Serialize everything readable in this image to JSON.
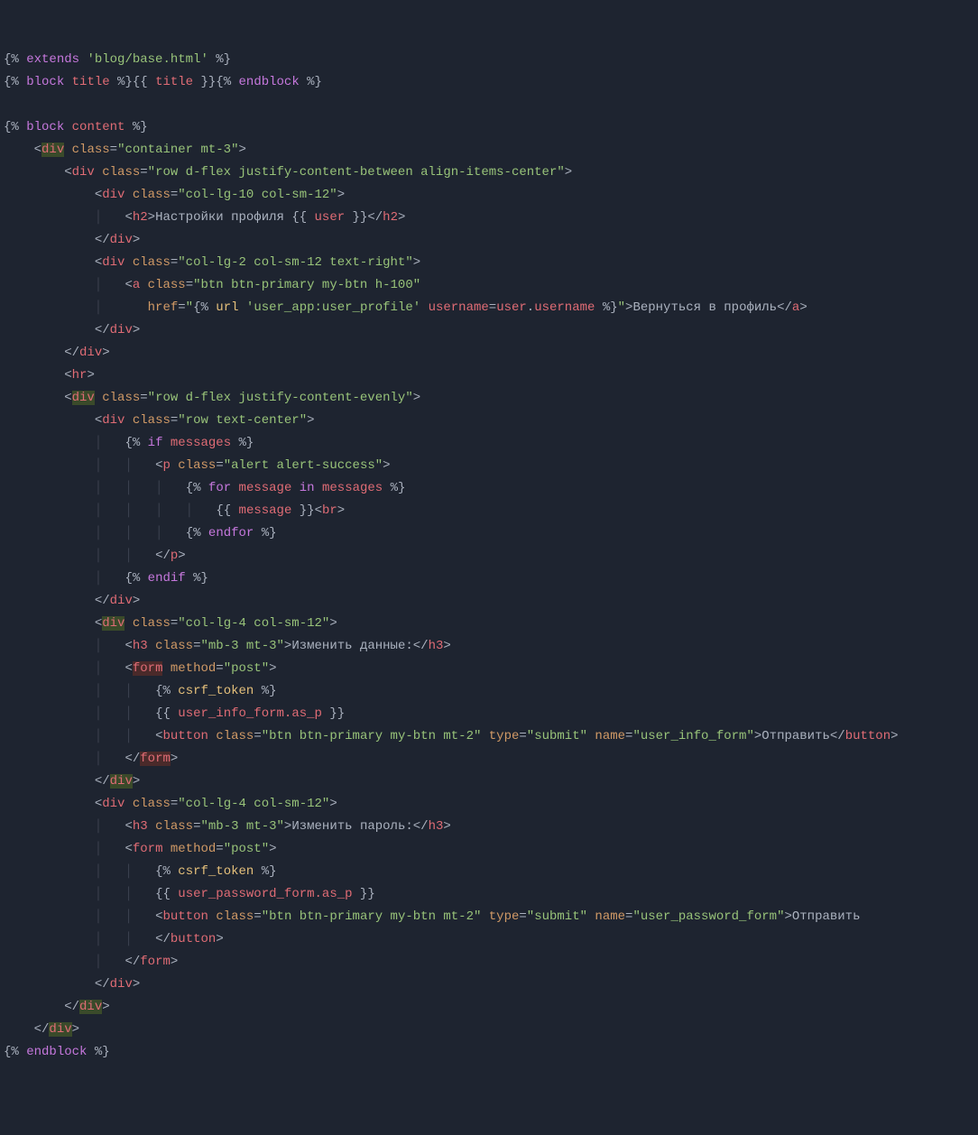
{
  "lines": {
    "l1": {
      "extends_path": "'blog/base.html'"
    },
    "l2": {
      "block_name": "title",
      "var": "title"
    },
    "l4": {
      "block_name": "content"
    },
    "l5": {
      "cls": "\"container mt-3\""
    },
    "l6": {
      "cls": "\"row d-flex justify-content-between align-items-center\""
    },
    "l7": {
      "cls": "\"col-lg-10 col-sm-12\""
    },
    "l8": {
      "text": "Настройки профиля ",
      "var": "user"
    },
    "l10": {
      "cls": "\"col-lg-2 col-sm-12 text-right\""
    },
    "l11": {
      "cls": "\"btn btn-primary my-btn h-100\""
    },
    "l12": {
      "url": "'user_app:user_profile'",
      "param": "username",
      "val": "user.username",
      "text": "Вернуться в профиль"
    },
    "l16": {
      "cls": "\"row d-flex justify-content-evenly\""
    },
    "l17": {
      "cls": "\"row text-center\""
    },
    "l18": {
      "var": "messages"
    },
    "l19": {
      "cls": "\"alert alert-success\""
    },
    "l20": {
      "var1": "message",
      "var2": "messages"
    },
    "l21": {
      "var": "message"
    },
    "l26": {
      "cls": "\"col-lg-4 col-sm-12\""
    },
    "l27": {
      "cls": "\"mb-3 mt-3\"",
      "text": "Изменить данные:"
    },
    "l28": {
      "method": "\"post\""
    },
    "l30": {
      "var": "user_info_form.as_p"
    },
    "l31": {
      "cls": "\"btn btn-primary my-btn mt-2\"",
      "type": "\"submit\"",
      "name": "\"user_info_form\"",
      "text": "Отправить"
    },
    "l34": {
      "cls": "\"col-lg-4 col-sm-12\""
    },
    "l35": {
      "cls": "\"mb-3 mt-3\"",
      "text": "Изменить пароль:"
    },
    "l36": {
      "method": "\"post\""
    },
    "l38": {
      "var": "user_password_form.as_p"
    },
    "l39": {
      "cls": "\"btn btn-primary my-btn mt-2\"",
      "type": "\"submit\"",
      "name": "\"user_password_form\"",
      "text": "Отправить"
    }
  }
}
